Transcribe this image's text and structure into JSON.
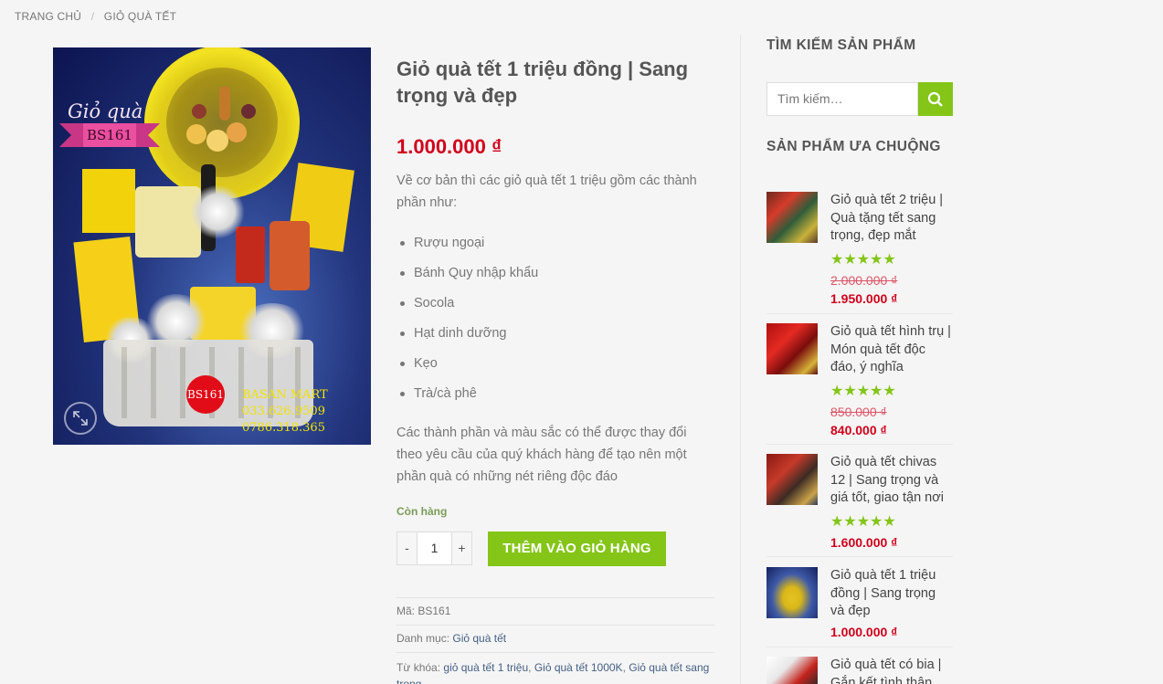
{
  "breadcrumb": {
    "home": "Trang chủ",
    "separator": "/",
    "category": "Giỏ quà tết"
  },
  "product": {
    "image": {
      "overlay_title": "Giỏ quà",
      "code_ribbon": "BS161",
      "code_circle": "BS161",
      "store_name": "BASAN MART",
      "phone1": "033.626.9509",
      "phone2": "0786.318.365"
    },
    "title": "Giỏ quà tết 1 triệu đồng | Sang trọng và đẹp",
    "price": "1.000.000 ₫",
    "intro": "Về cơ bản thì các giỏ quà tết 1 triệu gồm các thành phần như:",
    "components": [
      "Rượu ngoại",
      "Bánh Quy nhập khẩu",
      "Socola",
      "Hạt dinh dưỡng",
      "Kẹo",
      "Trà/cà phê"
    ],
    "note": "Các thành phần và màu sắc có thể được thay đổi theo yêu cầu của quý khách hàng để tạo nên một phần quà có những nét riêng độc đáo",
    "stock": "Còn hàng",
    "quantity": "1",
    "qty_minus": "-",
    "qty_plus": "+",
    "add_to_cart": "Thêm vào giỏ hàng",
    "sku_label": "Mã:",
    "sku": "BS161",
    "category_label": "Danh mục:",
    "category": "Giỏ quà tết",
    "tags_label": "Từ khóa:",
    "tags": [
      "giỏ quà tết 1 triệu",
      "Giỏ quà tết 1000K",
      "Giỏ quà tết sang trọng"
    ]
  },
  "sidebar": {
    "search_heading": "Tìm kiếm sản phẩm",
    "search_placeholder": "Tìm kiếm…",
    "popular_heading": "Sản phẩm ưa chuộng",
    "products": [
      {
        "title": "Giỏ quà tết 2 triệu | Quà tặng tết sang trọng, đẹp mắt",
        "stars": "★★★★★",
        "old_price": "2.000.000 ₫",
        "price": "1.950.000 ₫"
      },
      {
        "title": "Giỏ quà tết hình trụ | Món quà tết độc đáo, ý nghĩa",
        "stars": "★★★★★",
        "old_price": "850.000 ₫",
        "price": "840.000 ₫"
      },
      {
        "title": "Giỏ quà tết chivas 12 | Sang trọng và giá tốt, giao tận nơi",
        "stars": "★★★★★",
        "old_price": "",
        "price": "1.600.000 ₫"
      },
      {
        "title": "Giỏ quà tết 1 triệu đồng | Sang trọng và đẹp",
        "stars": "",
        "old_price": "",
        "price": "1.000.000 ₫"
      },
      {
        "title": "Giỏ quà tết có bia | Gắn kết tình thân",
        "stars": "",
        "old_price": "",
        "price": ""
      }
    ],
    "colors": {
      "accent": "#84c518",
      "price": "#d0011b"
    }
  }
}
